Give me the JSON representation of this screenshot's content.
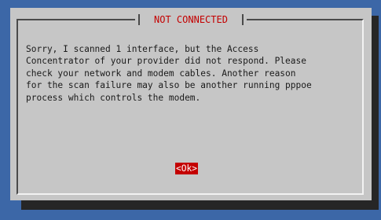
{
  "dialog": {
    "title": "NOT CONNECTED",
    "message": "Sorry, I scanned 1 interface, but the Access\nConcentrator of your provider did not respond. Please\ncheck your network and modem cables. Another reason\nfor the scan failure may also be another running pppoe\nprocess which controls the modem.",
    "ok_label": "<Ok>"
  },
  "colors": {
    "background": "#3c67a7",
    "dialog": "#c6c6c6",
    "shadow": "#262626",
    "title": "#c40000",
    "button": "#c40000"
  }
}
